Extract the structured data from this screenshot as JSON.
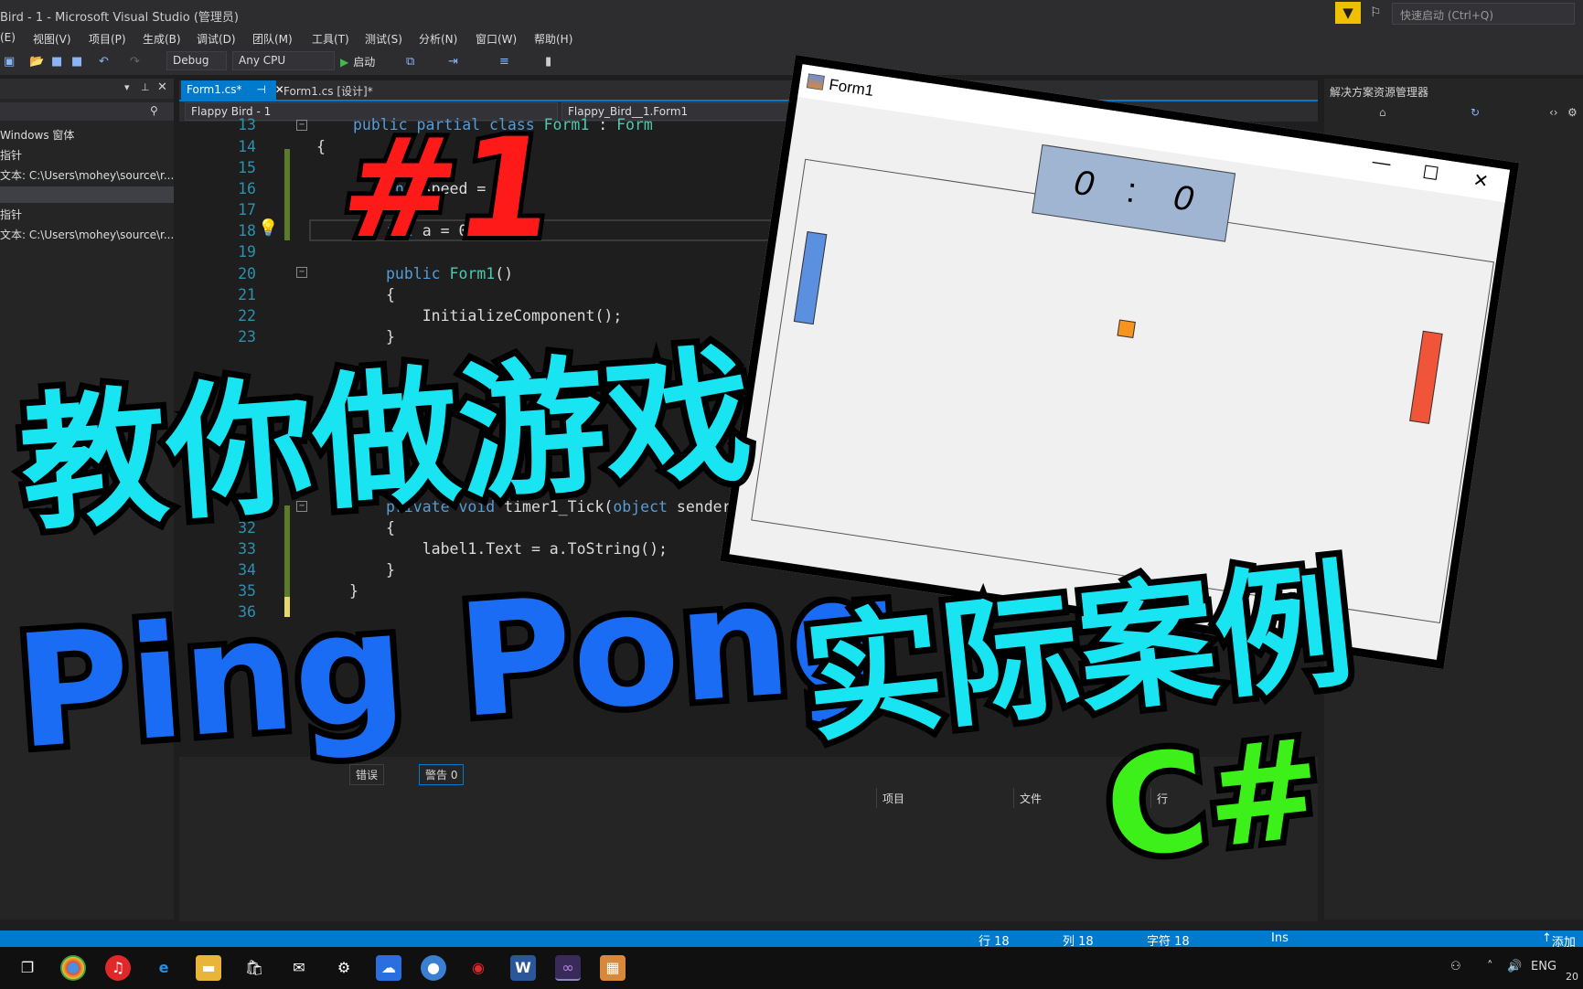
{
  "window": {
    "title": "Bird - 1 - Microsoft Visual Studio (管理员)",
    "quick_launch_placeholder": "快速启动 (Ctrl+Q)"
  },
  "menu": [
    "(E)",
    "视图(V)",
    "项目(P)",
    "生成(B)",
    "调试(D)",
    "团队(M)",
    "工具(T)",
    "测试(S)",
    "分析(N)",
    "窗口(W)",
    "帮助(H)"
  ],
  "toolbar": {
    "config": "Debug",
    "platform": "Any CPU",
    "start_label": "启动"
  },
  "left_panel": {
    "items": [
      "Windows 窗体",
      "指针",
      "文本: C:\\Users\\mohey\\source\\r...",
      "指针",
      "文本: C:\\Users\\mohey\\source\\r..."
    ]
  },
  "tabs": [
    {
      "label": "Form1.cs*",
      "active": true
    },
    {
      "label": "Form1.cs [设计]*",
      "active": false
    }
  ],
  "nav": {
    "project": "Flappy Bird - 1",
    "class": "Flappy_Bird__1.Form1"
  },
  "code_lines": [
    {
      "n": "13",
      "text": "public partial class Form1 : Form"
    },
    {
      "n": "14",
      "text": "{"
    },
    {
      "n": "15",
      "text": ""
    },
    {
      "n": "16",
      "text": "int speed = 12;"
    },
    {
      "n": "17",
      "text": ""
    },
    {
      "n": "18",
      "text": "int a = 0;"
    },
    {
      "n": "19",
      "text": ""
    },
    {
      "n": "20",
      "text": "public Form1()"
    },
    {
      "n": "21",
      "text": "{"
    },
    {
      "n": "22",
      "text": "    InitializeComponent();"
    },
    {
      "n": "23",
      "text": "}"
    },
    {
      "n": "31",
      "text": "private void timer1_Tick(object sender, EventArgs e)"
    },
    {
      "n": "32",
      "text": "{"
    },
    {
      "n": "33",
      "text": "    label1.Text = a.ToString();"
    },
    {
      "n": "34",
      "text": "}"
    },
    {
      "n": "35",
      "text": "}"
    },
    {
      "n": "36",
      "text": ""
    }
  ],
  "error_list": {
    "errors_label": "错误",
    "warnings_label": "警告 0",
    "columns": [
      "项目",
      "文件",
      "行"
    ]
  },
  "right_panel": {
    "title": "解决方案资源管理器"
  },
  "status": {
    "line": "行 18",
    "col": "列 18",
    "char": "字符 18",
    "mode": "Ins",
    "add": "添加"
  },
  "taskbar": {
    "lang": "ENG",
    "year_fragment": "20"
  },
  "form1": {
    "title": "Form1",
    "score_left": "0",
    "score_sep": ":",
    "score_right": "0"
  },
  "overlay": {
    "number": "#1",
    "headline": "教你做游戏",
    "game": "Ping Pong",
    "subtitle": "实际案例",
    "lang": "C#"
  },
  "colors": {
    "accent": "#007acc",
    "title_cyan": "#18e4f2",
    "title_blue": "#1a6cf5",
    "title_red": "#ff1a1a",
    "title_green": "#3df01a"
  }
}
